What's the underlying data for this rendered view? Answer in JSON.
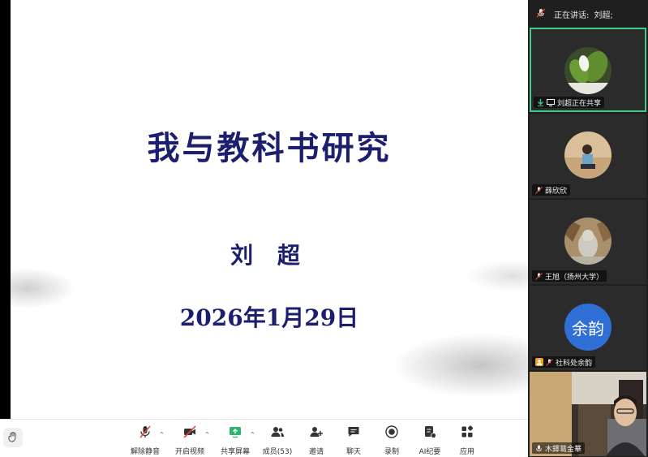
{
  "slide": {
    "title": "我与教科书研究",
    "author": "刘 超",
    "date": "2026年1月29日"
  },
  "panel": {
    "speaking_label": "正在讲话:",
    "speaking_name": "刘超;",
    "tiles": [
      {
        "name": "刘超正在共享",
        "avatar": "plant-photo"
      },
      {
        "name": "薛欣欣",
        "avatar": "person-photo"
      },
      {
        "name": "王旭（扬州大学）",
        "avatar": "statue-photo"
      },
      {
        "name": "社科处余韵",
        "avatar_text": "余韵"
      },
      {
        "name": "木鐸葛金華",
        "avatar": "camera-feed"
      }
    ]
  },
  "toolbar": {
    "unmute": "解除静音",
    "start_video": "开启视频",
    "share_screen": "共享屏幕",
    "members": "成员(53)",
    "invite": "邀请",
    "chat": "聊天",
    "record": "录制",
    "ai_minutes": "AI纪要",
    "apps": "应用"
  },
  "colors": {
    "title_ink": "#1b1f6e",
    "active_border": "#3ec88a",
    "share_green": "#2fb36c",
    "muted_red": "#e0463a",
    "avatar_blue": "#2f6fd6"
  }
}
